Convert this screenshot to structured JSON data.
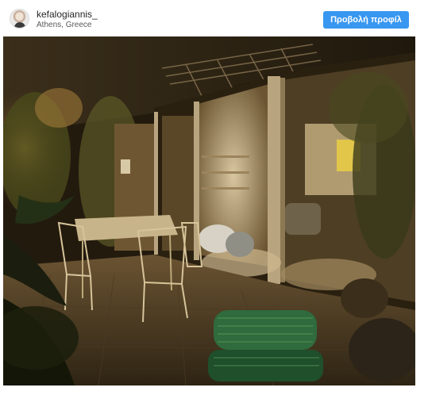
{
  "post": {
    "username": "kefalogiannis_",
    "location": "Athens, Greece",
    "profile_button": "Προβολή προφίλ"
  },
  "icons": {
    "avatar": "profile-avatar"
  },
  "colors": {
    "button_blue": "#3897f0",
    "username_text": "#262626"
  }
}
